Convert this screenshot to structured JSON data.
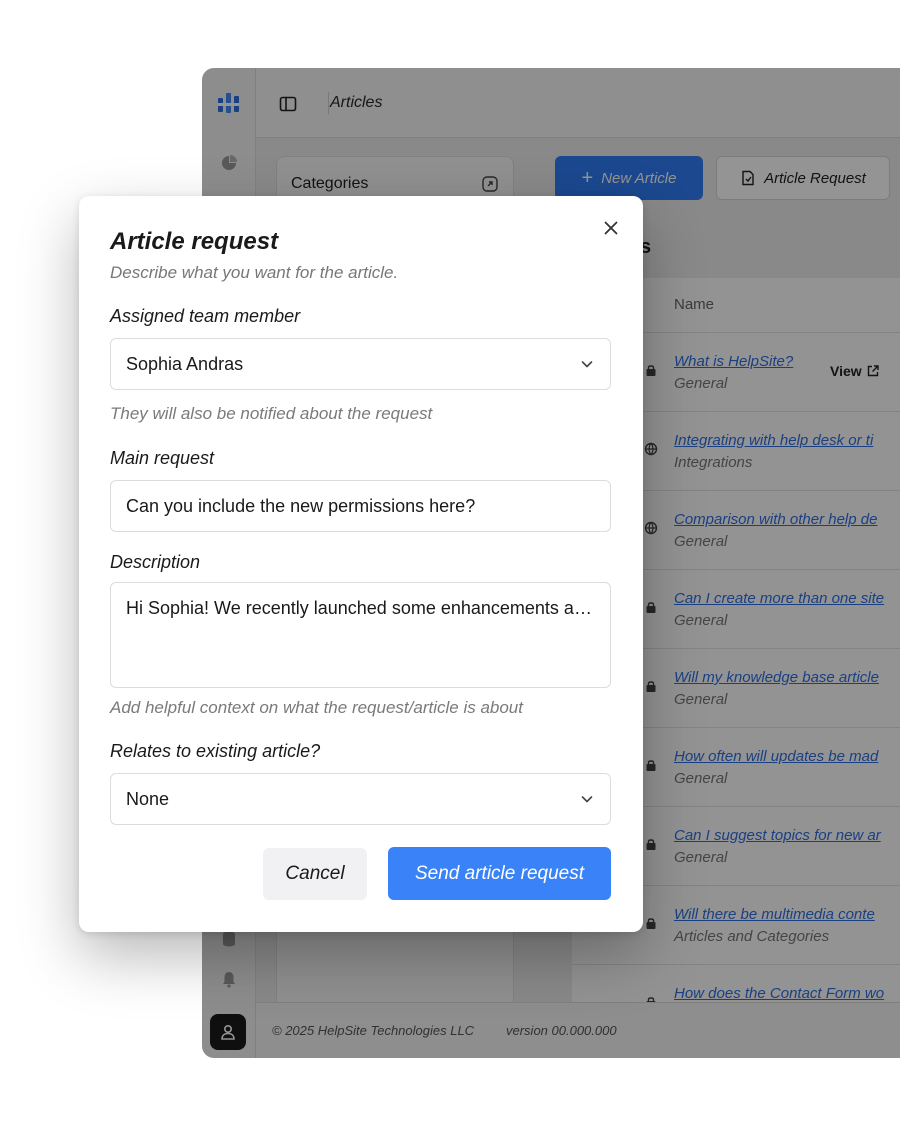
{
  "app": {
    "breadcrumb": "Articles",
    "categories_title": "Categories",
    "new_article_label": "New Article",
    "article_request_label": "Article Request",
    "heading_tail": "s",
    "column_name": "Name",
    "view_label": "View",
    "accent_color": "#2f7df6",
    "articles": [
      {
        "title": "What is HelpSite?",
        "category": "General",
        "icon": "lock-icon"
      },
      {
        "title": "Integrating with help desk or ti",
        "category": "Integrations",
        "icon": "globe-icon"
      },
      {
        "title": "Comparison with other help de",
        "category": "General",
        "icon": "globe-icon"
      },
      {
        "title": "Can I create more than one site",
        "category": "General",
        "icon": "lock-icon"
      },
      {
        "title": "Will my knowledge base article",
        "category": "General",
        "icon": "lock-icon"
      },
      {
        "title": "How often will updates be mad",
        "category": "General",
        "icon": "lock-icon"
      },
      {
        "title": "Can I suggest topics for new ar",
        "category": "General",
        "icon": "lock-icon"
      },
      {
        "title": "Will there be multimedia conte",
        "category": "Articles and Categories",
        "icon": "lock-icon"
      },
      {
        "title": "How does the Contact Form wo",
        "category": "",
        "icon": "lock-icon"
      }
    ],
    "footer_copyright": "© 2025 HelpSite Technologies LLC",
    "footer_version": "version 00.000.000"
  },
  "modal": {
    "title": "Article request",
    "subtitle": "Describe what you want for the article.",
    "assigned": {
      "label": "Assigned team member",
      "value": "Sophia Andras",
      "hint": "They will also be notified about the request"
    },
    "main_request": {
      "label": "Main request",
      "value": "Can you include the new permissions here?"
    },
    "description": {
      "label": "Description",
      "value": "Hi Sophia! We recently launched some enhancements and integrations with the visibility feature. Could you connect with the integrations team",
      "hint": "Add helpful context on what the request/article is about"
    },
    "relates": {
      "label": "Relates to existing article?",
      "value": "None"
    },
    "cancel_label": "Cancel",
    "send_label": "Send article request",
    "send_color": "#3a82f7"
  }
}
